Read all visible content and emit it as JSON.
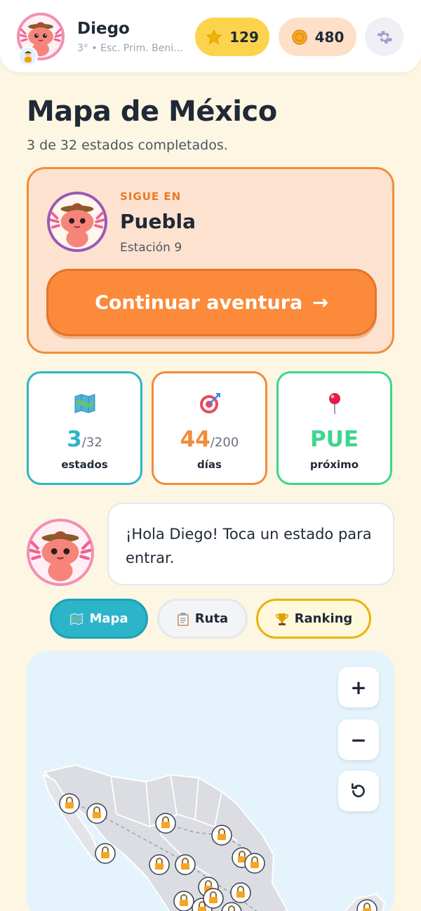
{
  "header": {
    "user_name": "Diego",
    "school": "3° • Esc. Prim. Beni...",
    "stars": "129",
    "coins": "480"
  },
  "page": {
    "title": "Mapa de México",
    "subtitle": "3 de 32 estados completados."
  },
  "continue_card": {
    "label": "SIGUE EN",
    "state": "Puebla",
    "station": "Estación 9",
    "button_label": "Continuar aventura",
    "button_arrow": "→"
  },
  "stats": [
    {
      "value": "3",
      "total": "/32",
      "label": "estados",
      "color": "#2cb5c9",
      "icon": "map-icon"
    },
    {
      "value": "44",
      "total": "/200",
      "label": "días",
      "color": "#f28c38",
      "icon": "target-icon"
    },
    {
      "value": "PUE",
      "total": "",
      "label": "próximo",
      "color": "#3dd68c",
      "icon": "pin-icon"
    }
  ],
  "speech": {
    "text": "¡Hola Diego! Toca un estado para entrar."
  },
  "tabs": [
    {
      "label": "Mapa",
      "icon": "map-icon",
      "active": true
    },
    {
      "label": "Ruta",
      "icon": "clipboard-icon",
      "active": false
    },
    {
      "label": "Ranking",
      "icon": "trophy-icon",
      "active": false
    }
  ],
  "map": {
    "zoom_in": "+",
    "zoom_out": "−"
  },
  "colors": {
    "background": "#fdf6e3",
    "accent_orange": "#fb8a3a",
    "accent_teal": "#2cb5c9",
    "accent_green": "#3dd68c",
    "star_pill": "#fcd34d"
  }
}
